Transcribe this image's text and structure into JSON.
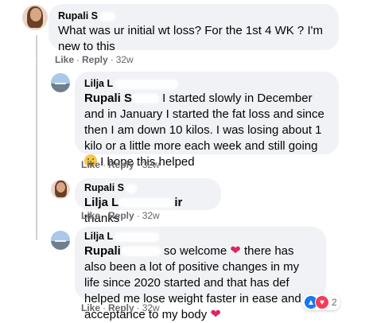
{
  "comments": [
    {
      "author": "Rupali S",
      "text": "What was ur initial wt loss? For the 1st 4 WK ? I'm new to this",
      "actions": {
        "like": "Like",
        "reply": "Reply",
        "time": "32w"
      }
    },
    {
      "author": "Lilja L",
      "mention": "Rupali S",
      "text_line1": " I started slowly in December and in",
      "text_rest": "January I started the fat loss and since then I am down 10 kilos. I was losing about 1 kilo or a little more each week and still going ",
      "text_end": " I hope this helped",
      "emoji": "grinning-face-icon",
      "actions": {
        "like": "Like",
        "reply": "Reply",
        "time": "32w"
      }
    },
    {
      "author": "Rupali S",
      "mention": "Lilja L",
      "mention_tail": "ir",
      "text": " thanks",
      "actions": {
        "like": "Like",
        "reply": "Reply",
        "time": "32w"
      }
    },
    {
      "author": "Lilja L",
      "mention": "Rupali",
      "text_line1": " so welcome ",
      "text_line1b": " there has also been",
      "text_rest": "a lot of positive changes in my life since 2020 started and that has def helped me lose weight faster in ease and acceptance to my body ",
      "actions": {
        "like": "Like",
        "reply": "Reply",
        "time": "32w"
      },
      "reactions": {
        "count": "2",
        "types": [
          "like",
          "love"
        ]
      }
    }
  ],
  "separator": "·",
  "colors": {
    "bubble": "#f0f2f5",
    "meta": "#65676b",
    "heart": "#e0245e",
    "like": "#1877f2",
    "love": "#f33e58"
  }
}
